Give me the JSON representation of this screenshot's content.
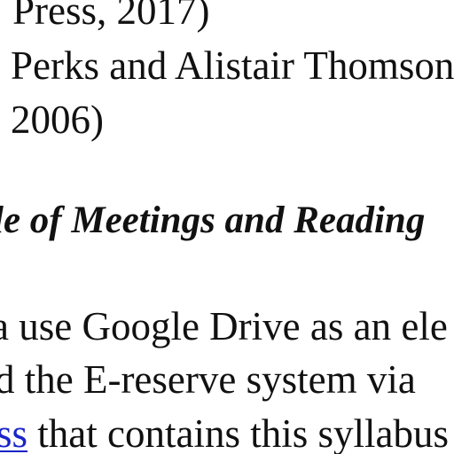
{
  "references": {
    "line1": "Press, 2017)",
    "line2": "Perks and Alistair Thomson",
    "line3": "2006)"
  },
  "section": {
    "heading": "le of  Meetings and Reading"
  },
  "body": {
    "line1": "a use Google Drive as an ele",
    "line2": "d the E-reserve system via",
    "line3_link": "ss",
    "line3_rest": " that contains this syllabus"
  },
  "colors": {
    "text": "#111111",
    "link": "#1a24c8",
    "background": "#ffffff"
  }
}
